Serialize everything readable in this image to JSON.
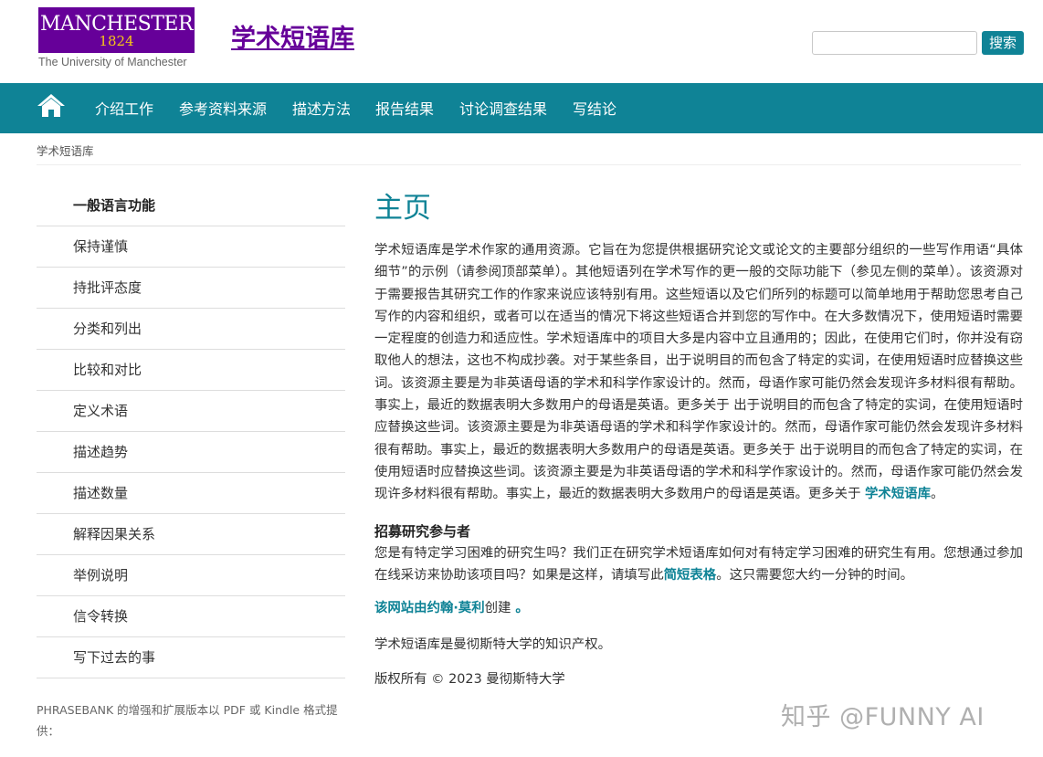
{
  "header": {
    "logo_word": "MANCHESTER",
    "logo_year": "1824",
    "logo_sub": "The University of Manchester",
    "site_title": "学术短语库",
    "search_placeholder": "",
    "search_label": "搜索"
  },
  "nav": {
    "home_icon": "home-icon",
    "items": [
      "介绍工作",
      "参考资料来源",
      "描述方法",
      "报告结果",
      "讨论调查结果",
      "写结论"
    ]
  },
  "breadcrumb": "学术短语库",
  "sidebar": {
    "heading": "一般语言功能",
    "items": [
      "保持谨慎",
      "持批评态度",
      "分类和列出",
      "比较和对比",
      "定义术语",
      "描述趋势",
      "描述数量",
      "解释因果关系",
      "举例说明",
      "信令转换",
      "写下过去的事"
    ],
    "note": "PHRASEBANK 的增强和扩展版本以 PDF 或 Kindle 格式提供："
  },
  "main": {
    "title": "主页",
    "intro": "学术短语库是学术作家的通用资源。它旨在为您提供根据研究论文或论文的主要部分组织的一些写作用语“具体细节”的示例（请参阅顶部菜单）。其他短语列在学术写作的更一般的交际功能下（参见左侧的菜单）。该资源对于需要报告其研究工作的作家来说应该特别有用。这些短语以及它们所列的标题可以简单地用于帮助您思考自己写作的内容和组织，或者可以在适当的情况下将这些短语合并到您的写作中。在大多数情况下，使用短语时需要一定程度的创造力和适应性。学术短语库中的项目大多是内容中立且通用的；因此，在使用它们时，你并没有窃取他人的想法，这也不构成抄袭。对于某些条目，出于说明目的而包含了特定的实词，在使用短语时应替换这些词。该资源主要是为非英语母语的学术和科学作家设计的。然而，母语作家可能仍然会发现许多材料很有帮助。事实上，最近的数据表明大多数用户的母语是英语。更多关于 出于说明目的而包含了特定的实词，在使用短语时应替换这些词。该资源主要是为非英语母语的学术和科学作家设计的。然而，母语作家可能仍然会发现许多材料很有帮助。事实上，最近的数据表明大多数用户的母语是英语。更多关于 出于说明目的而包含了特定的实词，在使用短语时应替换这些词。该资源主要是为非英语母语的学术和科学作家设计的。然而，母语作家可能仍然会发现许多材料很有帮助。事实上，最近的数据表明大多数用户的母语是英语。更多关于 ",
    "intro_link": "学术短语库",
    "intro_end": "。",
    "recruit_heading": "招募研究参与者",
    "recruit_text": "您是有特定学习困难的研究生吗？我们正在研究学术短语库如何对有特定学习困难的研究生有用。您想通过参加在线采访来协助该项目吗？如果是这样，请填写此",
    "recruit_link": "简短表格",
    "recruit_end": "。这只需要您大约一分钟的时间。",
    "credit_link": "该网站由约翰·莫利",
    "credit_text": "创建",
    "credit_end": " 。",
    "ip_text": "学术短语库是曼彻斯特大学的知识产权。",
    "copyright": "版权所有 © 2023 曼彻斯特大学"
  },
  "watermark": "知乎 @FUNNY AI",
  "colors": {
    "brand_purple": "#660099",
    "teal": "#0f8396",
    "gold": "#f5c518"
  }
}
